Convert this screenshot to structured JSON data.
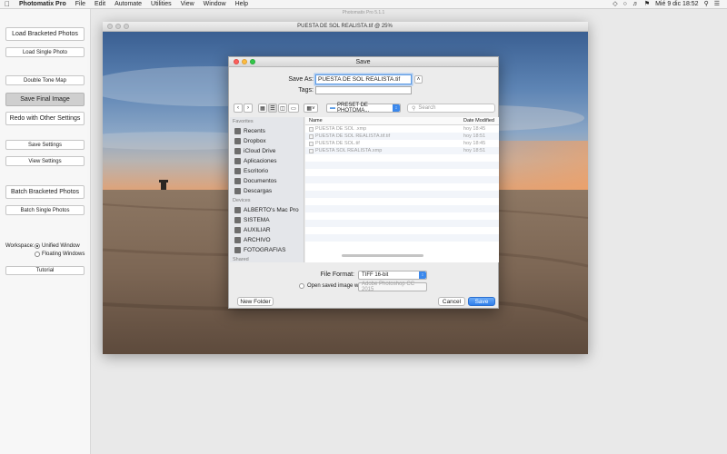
{
  "menubar": {
    "app_name": "Photomatix Pro",
    "items": [
      "File",
      "Edit",
      "Automate",
      "Utilities",
      "View",
      "Window",
      "Help"
    ],
    "clock": "Mié 9 dic  18:52"
  },
  "ghost_title": "Photomatix Pro 5.1.1",
  "left_panel": {
    "load_bracketed": "Load Bracketed Photos",
    "load_single": "Load Single Photo",
    "double_tone_map": "Double Tone Map",
    "save_final": "Save Final Image",
    "redo": "Redo with Other Settings",
    "save_settings": "Save Settings",
    "view_settings": "View Settings",
    "batch_bracketed": "Batch Bracketed Photos",
    "batch_single": "Batch Single Photos",
    "workspace_label": "Workspace:",
    "unified": "Unified Window",
    "floating": "Floating Windows",
    "tutorial": "Tutorial"
  },
  "image_window": {
    "title": "PUESTA DE SOL REALISTA.tif @ 25%"
  },
  "dialog": {
    "title": "Save",
    "save_as_label": "Save As:",
    "save_as_value": "PUESTA DE SOL REALISTA.tif",
    "tags_label": "Tags:",
    "tags_value": "",
    "location": "PRESET DE PHOTOMA...",
    "search_placeholder": "Search",
    "sidebar": {
      "favorites_label": "Favorites",
      "favorites": [
        "Recents",
        "Dropbox",
        "iCloud Drive",
        "Aplicaciones",
        "Escritorio",
        "Documentos",
        "Descargas"
      ],
      "devices_label": "Devices",
      "devices": [
        "ALBERTO's Mac Pro",
        "SISTEMA",
        "AUXILIAR",
        "ARCHIVO",
        "FOTOGRAFIAS"
      ],
      "shared_label": "Shared"
    },
    "columns": {
      "name": "Name",
      "date": "Date Modified"
    },
    "files": [
      {
        "name": "PUESTA DE SOL .xmp",
        "date": "hoy 18:45"
      },
      {
        "name": "PUESTA DE SOL REALISTA.tif.tif",
        "date": "hoy 18:51"
      },
      {
        "name": "PUESTA DE SOL.tif",
        "date": "hoy 18:45"
      },
      {
        "name": "PUESTA SOL REALISTA.xmp",
        "date": "hoy 18:51"
      }
    ],
    "file_format_label": "File Format:",
    "file_format_value": "TIFF 16-bit",
    "open_with_label": "Open saved image with:",
    "open_with_value": "Adobe Photoshop CC 2015",
    "new_folder": "New Folder",
    "cancel": "Cancel",
    "save": "Save"
  }
}
